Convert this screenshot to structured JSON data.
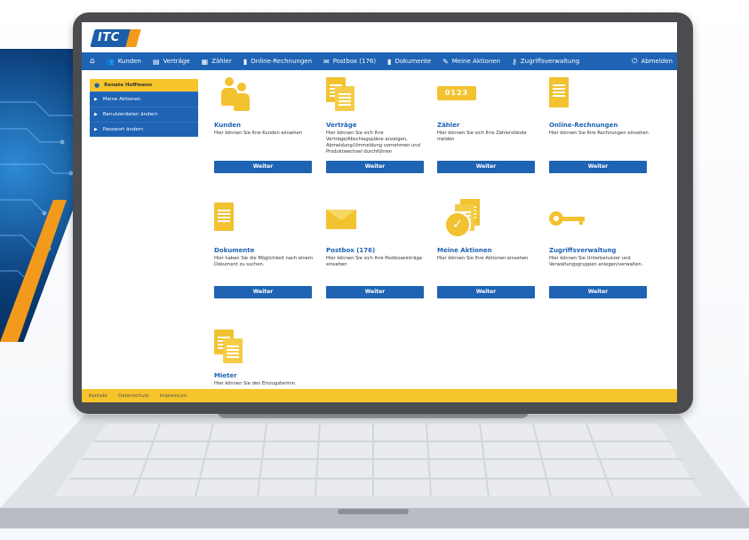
{
  "app": {
    "logo_text": "ITC"
  },
  "nav": {
    "items": [
      {
        "label": "Kunden",
        "icon": "users-icon"
      },
      {
        "label": "Verträge",
        "icon": "contracts-icon"
      },
      {
        "label": "Zähler",
        "icon": "meter-icon"
      },
      {
        "label": "Online-Rechnungen",
        "icon": "invoice-icon"
      },
      {
        "label": "Postbox (176)",
        "icon": "envelope-icon"
      },
      {
        "label": "Dokumente",
        "icon": "document-icon"
      },
      {
        "label": "Meine Aktionen",
        "icon": "actions-icon"
      },
      {
        "label": "Zugriffsverwaltung",
        "icon": "key-icon"
      }
    ],
    "logout_label": "Abmelden"
  },
  "sidebar": {
    "user_name": "Renate Hoffmann",
    "items": [
      "Meine Aktionen",
      "Benutzerdaten ändern",
      "Passwort ändern"
    ]
  },
  "cards": [
    {
      "title": "Kunden",
      "desc": "Hier können Sie Ihre Kunden einsehen",
      "button": "Weiter",
      "icon": "customers-icon"
    },
    {
      "title": "Verträge",
      "desc": "Hier können Sie sich Ihre Verträge/Abschlagspläne anzeigen, Abmeldung/Ummeldung vornehmen und Produktwechsel durchführen",
      "button": "Weiter",
      "icon": "contracts-icon"
    },
    {
      "title": "Zähler",
      "desc": "Hier können Sie sich Ihre Zählerstände melden",
      "button": "Weiter",
      "icon": "meter-icon",
      "meter_text": "0123"
    },
    {
      "title": "Online-Rechnungen",
      "desc": "Hier können Sie Ihre Rechnungen einsehen",
      "button": "Weiter",
      "icon": "invoice-icon"
    },
    {
      "title": "Dokumente",
      "desc": "Hier haben Sie die Möglichkeit nach einem Dokument zu suchen.",
      "button": "Weiter",
      "icon": "document-icon"
    },
    {
      "title": "Postbox (176)",
      "desc": "Hier können Sie sich Ihre Postboxeinträge einsehen",
      "button": "Weiter",
      "icon": "envelope-icon"
    },
    {
      "title": "Meine Aktionen",
      "desc": "Hier können Sie Ihre Aktionen einsehen",
      "button": "Weiter",
      "icon": "check-icon"
    },
    {
      "title": "Zugriffsverwaltung",
      "desc": "Hier können Sie Unterbenutzer und Verwaltungsgruppen anlegen/verwalten.",
      "button": "Weiter",
      "icon": "key-icon"
    },
    {
      "title": "Mieter",
      "desc": "Hier können Sie den Einzugstermin",
      "button": "",
      "icon": "tenants-icon"
    }
  ],
  "footer": {
    "links": [
      "Kontakt",
      "Datenschutz",
      "Impressum"
    ]
  },
  "colors": {
    "primary": "#1e63b4",
    "accent": "#f6c42b",
    "brand_orange": "#f39a1d"
  }
}
